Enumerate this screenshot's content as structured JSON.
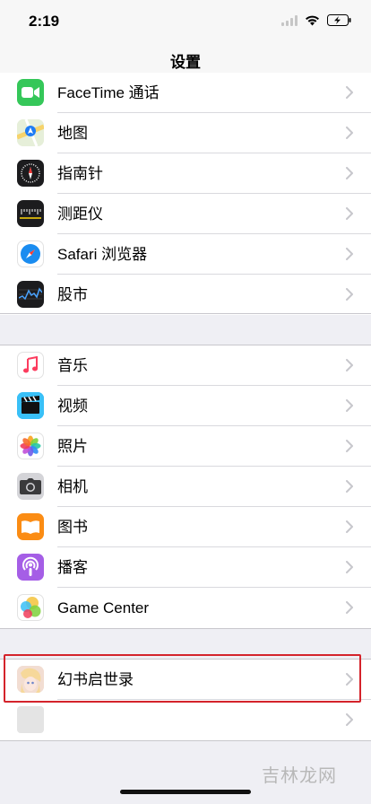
{
  "status_bar": {
    "time": "2:19"
  },
  "nav": {
    "title": "设置"
  },
  "group1": [
    {
      "label": "FaceTime 通话",
      "icon": "facetime-icon"
    },
    {
      "label": "地图",
      "icon": "maps-icon"
    },
    {
      "label": "指南针",
      "icon": "compass-icon"
    },
    {
      "label": "测距仪",
      "icon": "measure-icon"
    },
    {
      "label": "Safari 浏览器",
      "icon": "safari-icon"
    },
    {
      "label": "股市",
      "icon": "stocks-icon"
    }
  ],
  "group2": [
    {
      "label": "音乐",
      "icon": "music-icon"
    },
    {
      "label": "视频",
      "icon": "tv-icon"
    },
    {
      "label": "照片",
      "icon": "photos-icon"
    },
    {
      "label": "相机",
      "icon": "camera-icon"
    },
    {
      "label": "图书",
      "icon": "books-icon"
    },
    {
      "label": "播客",
      "icon": "podcasts-icon"
    },
    {
      "label": "Game Center",
      "icon": "game-center-icon"
    }
  ],
  "group3": [
    {
      "label": "幻书启世录",
      "icon": "game-app-icon"
    },
    {
      "label": "",
      "icon": "blank-app-icon"
    }
  ],
  "watermark": "吉林龙网",
  "colors": {
    "highlight": "#d4232b",
    "chevron": "#c7c7cc",
    "background": "#efeff4"
  }
}
